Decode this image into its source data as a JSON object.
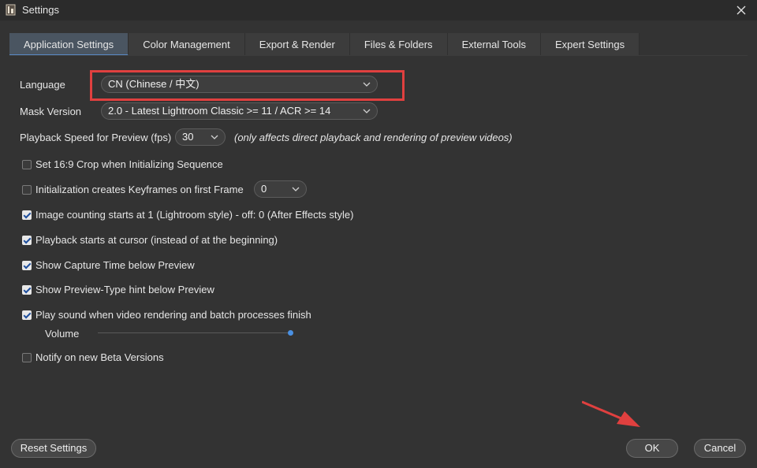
{
  "window": {
    "title": "Settings"
  },
  "tabs": [
    {
      "label": "Application Settings",
      "active": true
    },
    {
      "label": "Color Management"
    },
    {
      "label": "Export & Render"
    },
    {
      "label": "Files & Folders"
    },
    {
      "label": "External Tools"
    },
    {
      "label": "Expert Settings"
    }
  ],
  "language": {
    "label": "Language",
    "value": "CN (Chinese / 中文)"
  },
  "mask_version": {
    "label": "Mask Version",
    "value": "2.0 - Latest Lightroom Classic >= 11 / ACR >= 14"
  },
  "playback_speed": {
    "label": "Playback Speed for Preview (fps)",
    "value": "30",
    "hint": "(only affects direct playback and rendering of preview videos)"
  },
  "options": {
    "crop_16_9": {
      "label": "Set 16:9 Crop when Initializing Sequence",
      "checked": false
    },
    "init_keyframes": {
      "label": "Initialization creates Keyframes on first Frame",
      "checked": false,
      "value": "0"
    },
    "image_counting": {
      "label": "Image counting starts at 1 (Lightroom style) - off: 0 (After Effects style)",
      "checked": true
    },
    "playback_cursor": {
      "label": "Playback starts at cursor (instead of at the beginning)",
      "checked": true
    },
    "capture_time": {
      "label": "Show Capture Time below Preview",
      "checked": true
    },
    "preview_type_hint": {
      "label": "Show Preview-Type hint below Preview",
      "checked": true
    },
    "play_sound": {
      "label": "Play sound when video rendering and batch processes finish",
      "checked": true
    },
    "beta_versions": {
      "label": "Notify on new Beta Versions",
      "checked": false
    }
  },
  "volume": {
    "label": "Volume",
    "level": 1.0
  },
  "buttons": {
    "reset": "Reset Settings",
    "ok": "OK",
    "cancel": "Cancel"
  },
  "colors": {
    "accent": "#4a90e2",
    "highlight": "#e0403f",
    "background": "#333333",
    "tab_active": "#4a5561"
  }
}
